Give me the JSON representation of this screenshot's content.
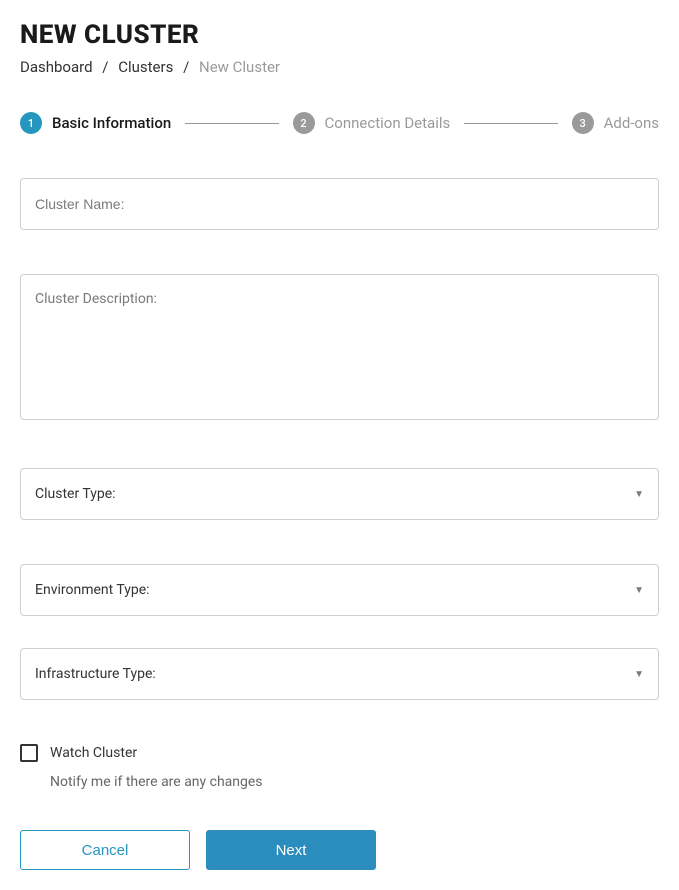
{
  "header": {
    "title": "NEW CLUSTER"
  },
  "breadcrumbs": {
    "items": [
      "Dashboard",
      "Clusters"
    ],
    "current": "New Cluster",
    "separator": "/"
  },
  "stepper": {
    "steps": [
      {
        "num": "1",
        "label": "Basic Information",
        "active": true
      },
      {
        "num": "2",
        "label": "Connection Details",
        "active": false
      },
      {
        "num": "3",
        "label": "Add-ons",
        "active": false
      }
    ]
  },
  "form": {
    "cluster_name": {
      "placeholder": "Cluster Name:",
      "value": ""
    },
    "cluster_description": {
      "placeholder": "Cluster Description:",
      "value": ""
    },
    "cluster_type": {
      "label": "Cluster Type:"
    },
    "environment_type": {
      "label": "Environment Type:"
    },
    "infrastructure_type": {
      "label": "Infrastructure Type:"
    },
    "watch_cluster": {
      "label": "Watch Cluster",
      "sublabel": "Notify me if there are any changes",
      "checked": false
    }
  },
  "actions": {
    "cancel": "Cancel",
    "next": "Next"
  }
}
